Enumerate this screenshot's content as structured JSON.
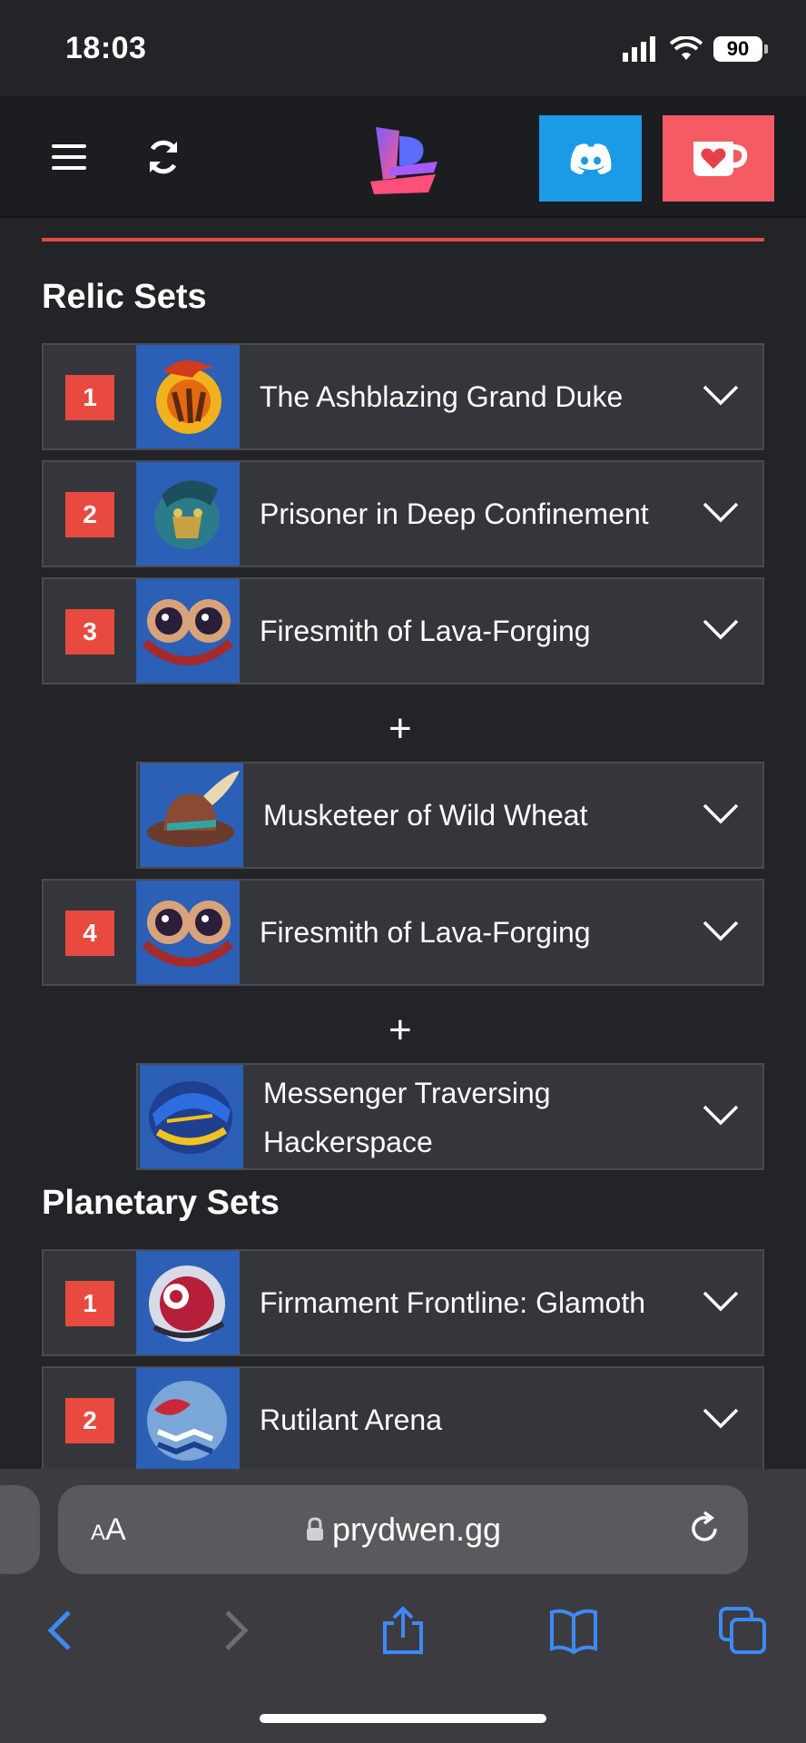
{
  "status": {
    "time": "18:03",
    "battery": "90"
  },
  "header": {
    "menu_icon": "hamburger-icon",
    "refresh_icon": "refresh-icon",
    "discord_icon": "discord-icon",
    "kofi_icon": "coffee-heart-icon",
    "accent": "#e84a3f"
  },
  "relic_section": {
    "title": "Relic Sets",
    "rows": [
      {
        "rank": "1",
        "name": "The Ashblazing Grand Duke"
      },
      {
        "rank": "2",
        "name": "Prisoner in Deep Confinement"
      },
      {
        "rank": "3",
        "name": "Firesmith of Lava-Forging"
      },
      {
        "rank": "",
        "name": "Musketeer of Wild Wheat"
      },
      {
        "rank": "4",
        "name": "Firesmith of Lava-Forging"
      },
      {
        "rank": "",
        "name": "Messenger Traversing Hackerspace"
      }
    ],
    "plus": "+"
  },
  "planetary_section": {
    "title": "Planetary Sets",
    "rows": [
      {
        "rank": "1",
        "name": "Firmament Frontline: Glamoth"
      },
      {
        "rank": "2",
        "name": "Rutilant Arena"
      }
    ]
  },
  "browser": {
    "aa_label_small": "A",
    "aa_label": "A",
    "domain": "prydwen.gg"
  }
}
